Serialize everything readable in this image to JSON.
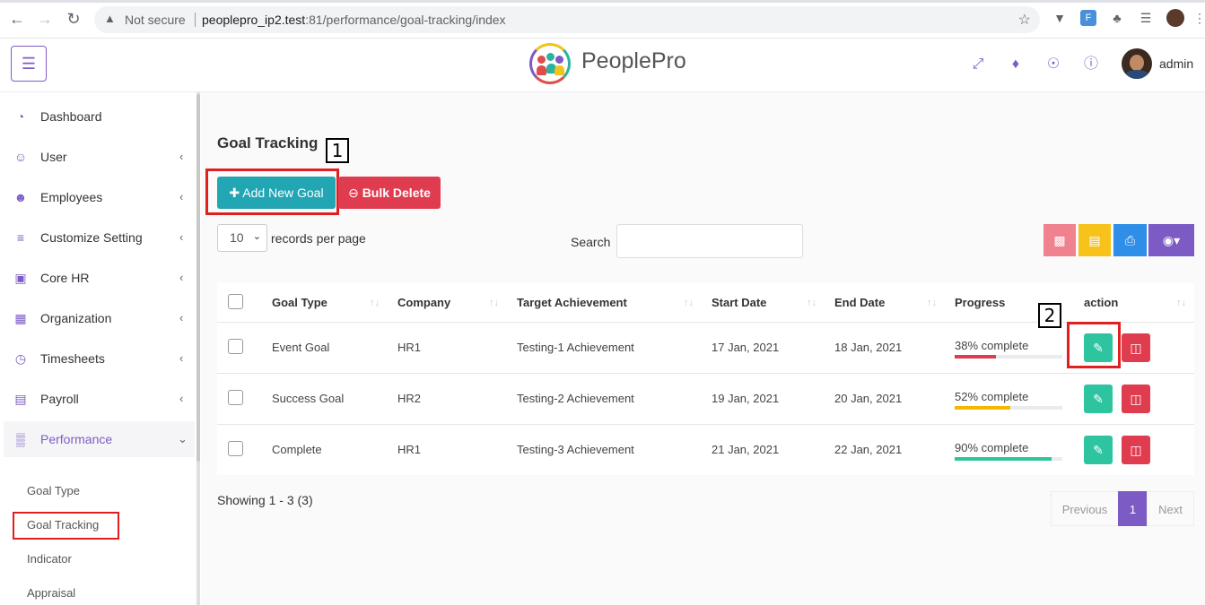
{
  "browser": {
    "security": "Not secure",
    "url_host": "peoplepro_ip2.test",
    "url_path": ":81/performance/goal-tracking/index"
  },
  "header": {
    "brand": "PeoplePro",
    "user": "admin"
  },
  "sidebar": {
    "items": [
      {
        "label": "Dashboard",
        "icon": "dashboard-icon"
      },
      {
        "label": "User",
        "icon": "user-icon"
      },
      {
        "label": "Employees",
        "icon": "employees-icon"
      },
      {
        "label": "Customize Setting",
        "icon": "sliders-icon"
      },
      {
        "label": "Core HR",
        "icon": "briefcase-icon"
      },
      {
        "label": "Organization",
        "icon": "grid-icon"
      },
      {
        "label": "Timesheets",
        "icon": "clock-icon"
      },
      {
        "label": "Payroll",
        "icon": "calendar-icon"
      },
      {
        "label": "Performance",
        "icon": "bar-chart-icon"
      }
    ],
    "sub_items": [
      "Goal Type",
      "Goal Tracking",
      "Indicator",
      "Appraisal"
    ]
  },
  "page": {
    "title": "Goal Tracking",
    "add_button": "Add New Goal",
    "bulk_delete_button": "Bulk Delete",
    "records_value": "10",
    "records_label": "records per page",
    "search_label": "Search",
    "callout_1": "1",
    "callout_2": "2"
  },
  "table": {
    "headers": [
      "Goal Type",
      "Company",
      "Target Achievement",
      "Start Date",
      "End Date",
      "Progress",
      "action"
    ],
    "rows": [
      {
        "goal_type": "Event Goal",
        "company": "HR1",
        "target": "Testing-1 Achievement",
        "start": "17 Jan, 2021",
        "end": "18 Jan, 2021",
        "progress_label": "38% complete",
        "progress": 38,
        "color": "#e03c4f"
      },
      {
        "goal_type": "Success Goal",
        "company": "HR2",
        "target": "Testing-2 Achievement",
        "start": "19 Jan, 2021",
        "end": "20 Jan, 2021",
        "progress_label": "52% complete",
        "progress": 52,
        "color": "#f5b800"
      },
      {
        "goal_type": "Complete",
        "company": "HR1",
        "target": "Testing-3 Achievement",
        "start": "21 Jan, 2021",
        "end": "22 Jan, 2021",
        "progress_label": "90% complete",
        "progress": 90,
        "color": "#2ec4a0"
      }
    ]
  },
  "footer": {
    "showing": "Showing 1 - 3 (3)",
    "previous": "Previous",
    "current_page": "1",
    "next": "Next"
  },
  "colors": {
    "accent": "#7c5cc4",
    "teal": "#22a6b3",
    "danger": "#e03c4f"
  }
}
